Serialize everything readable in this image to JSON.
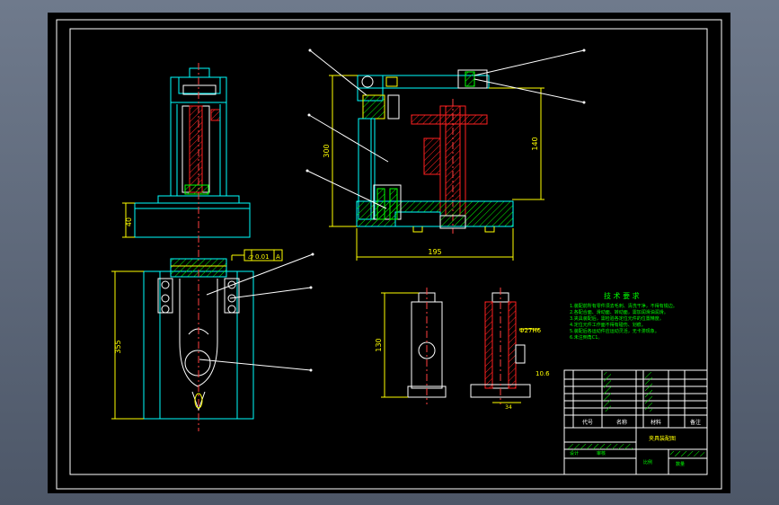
{
  "dimensions": {
    "top_left_height": "40",
    "front_width": "195",
    "front_height_left": "300",
    "front_height_right": "140",
    "bottom_left_height": "355",
    "bush_height": "130",
    "flatness_value": "0.01",
    "flatness_datum": "A",
    "bush_bore": "Φ27H6",
    "bush_step": "10.6",
    "bush_base": "34"
  },
  "tech_requirements": {
    "title": "技 术 要 求",
    "lines": [
      "1.装配前所有零件须去毛刺、清洗干净，不得有锐边。",
      "2.各配合面、滑动面、转动面，需加润滑油润滑。",
      "3.夹具装配后，需检验各定位元件的位置精度。",
      "4.定位元件工作面不得有碰伤、划痕。",
      "5.装配后各运动件应运动灵活，无卡滞现象。",
      "6.未注倒角C1。"
    ]
  },
  "title_block": {
    "drawing_name": "夹具装配图",
    "scale_label": "比例",
    "quantity_label": "数量",
    "code_label": "代号",
    "name_label": "名称",
    "material_label": "材料",
    "remark_label": "备注",
    "designer_label": "设计",
    "checker_label": "审核"
  },
  "colors": {
    "background": "#000000",
    "outline": "#00ffff",
    "detail": "#ffffff",
    "section": "#ff2020",
    "hatch": "#00ff00",
    "annotation": "#ffff00",
    "centerline": "#ff4040"
  }
}
